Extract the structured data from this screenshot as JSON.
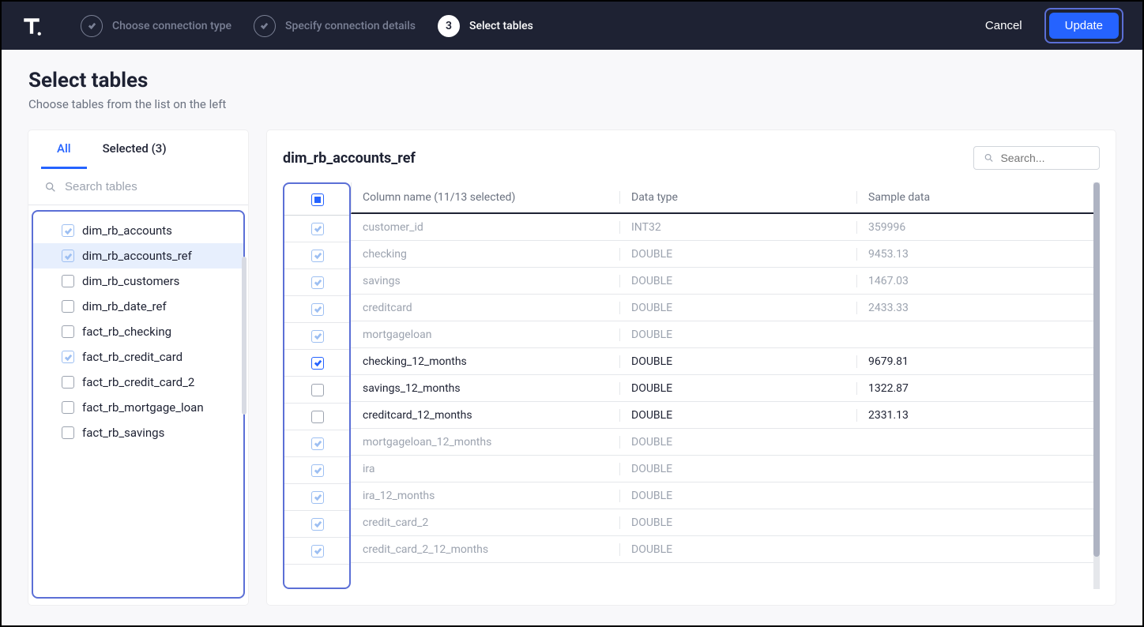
{
  "topbar": {
    "steps": [
      {
        "label": "Choose connection type",
        "state": "done"
      },
      {
        "label": "Specify connection details",
        "state": "done"
      },
      {
        "label": "Select tables",
        "state": "active",
        "num": "3"
      }
    ],
    "cancel": "Cancel",
    "update": "Update"
  },
  "page": {
    "title": "Select tables",
    "subtitle": "Choose tables from the list on the left"
  },
  "sidebar": {
    "tab_all": "All",
    "tab_selected": "Selected (3)",
    "search_placeholder": "Search tables",
    "tables": [
      {
        "name": "dim_rb_accounts",
        "checked": true,
        "active": false
      },
      {
        "name": "dim_rb_accounts_ref",
        "checked": true,
        "active": true
      },
      {
        "name": "dim_rb_customers",
        "checked": false,
        "active": false
      },
      {
        "name": "dim_rb_date_ref",
        "checked": false,
        "active": false
      },
      {
        "name": "fact_rb_checking",
        "checked": false,
        "active": false
      },
      {
        "name": "fact_rb_credit_card",
        "checked": true,
        "active": false
      },
      {
        "name": "fact_rb_credit_card_2",
        "checked": false,
        "active": false
      },
      {
        "name": "fact_rb_mortgage_loan",
        "checked": false,
        "active": false
      },
      {
        "name": "fact_rb_savings",
        "checked": false,
        "active": false
      }
    ]
  },
  "detail": {
    "title": "dim_rb_accounts_ref",
    "search_placeholder": "Search...",
    "header_col": "Column name (11/13 selected)",
    "header_type": "Data type",
    "header_sample": "Sample data",
    "rows": [
      {
        "name": "customer_id",
        "type": "INT32",
        "sample": "359996",
        "checked": true,
        "muted": true
      },
      {
        "name": "checking",
        "type": "DOUBLE",
        "sample": "9453.13",
        "checked": true,
        "muted": true
      },
      {
        "name": "savings",
        "type": "DOUBLE",
        "sample": "1467.03",
        "checked": true,
        "muted": true
      },
      {
        "name": "creditcard",
        "type": "DOUBLE",
        "sample": "2433.33",
        "checked": true,
        "muted": true
      },
      {
        "name": "mortgageloan",
        "type": "DOUBLE",
        "sample": "",
        "checked": true,
        "muted": true
      },
      {
        "name": "checking_12_months",
        "type": "DOUBLE",
        "sample": "9679.81",
        "checked": true,
        "muted": false
      },
      {
        "name": "savings_12_months",
        "type": "DOUBLE",
        "sample": "1322.87",
        "checked": false,
        "muted": false
      },
      {
        "name": "creditcard_12_months",
        "type": "DOUBLE",
        "sample": "2331.13",
        "checked": false,
        "muted": false
      },
      {
        "name": "mortgageloan_12_months",
        "type": "DOUBLE",
        "sample": "",
        "checked": true,
        "muted": true
      },
      {
        "name": "ira",
        "type": "DOUBLE",
        "sample": "",
        "checked": true,
        "muted": true
      },
      {
        "name": "ira_12_months",
        "type": "DOUBLE",
        "sample": "",
        "checked": true,
        "muted": true
      },
      {
        "name": "credit_card_2",
        "type": "DOUBLE",
        "sample": "",
        "checked": true,
        "muted": true
      },
      {
        "name": "credit_card_2_12_months",
        "type": "DOUBLE",
        "sample": "",
        "checked": true,
        "muted": true
      }
    ]
  }
}
